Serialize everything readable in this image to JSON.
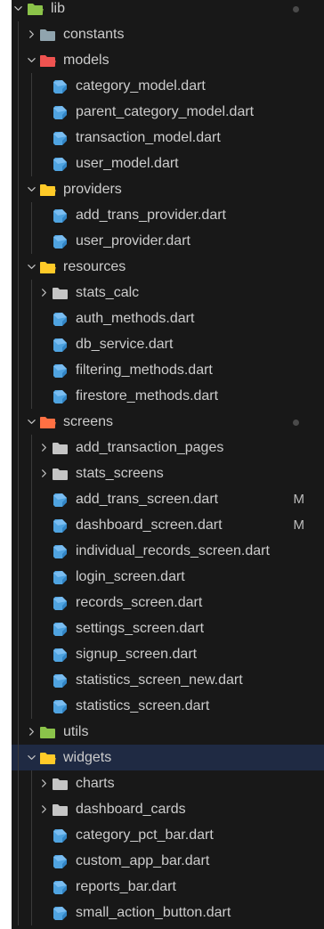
{
  "explorer": {
    "rows": [
      {
        "depth": 0,
        "type": "folder",
        "label": "lib",
        "expanded": true,
        "icon": "folder-open-lib-icon",
        "color": "#8bc34a",
        "dot": true
      },
      {
        "depth": 1,
        "type": "folder",
        "label": "constants",
        "expanded": false,
        "icon": "folder-constants-icon",
        "color": "#90a4ae"
      },
      {
        "depth": 1,
        "type": "folder",
        "label": "models",
        "expanded": true,
        "icon": "folder-open-models-icon",
        "color": "#ef5350"
      },
      {
        "depth": 2,
        "type": "file",
        "label": "category_model.dart",
        "icon": "dart-file-icon"
      },
      {
        "depth": 2,
        "type": "file",
        "label": "parent_category_model.dart",
        "icon": "dart-file-icon"
      },
      {
        "depth": 2,
        "type": "file",
        "label": "transaction_model.dart",
        "icon": "dart-file-icon"
      },
      {
        "depth": 2,
        "type": "file",
        "label": "user_model.dart",
        "icon": "dart-file-icon"
      },
      {
        "depth": 1,
        "type": "folder",
        "label": "providers",
        "expanded": true,
        "icon": "folder-open-providers-icon",
        "color": "#ffca28"
      },
      {
        "depth": 2,
        "type": "file",
        "label": "add_trans_provider.dart",
        "icon": "dart-file-icon"
      },
      {
        "depth": 2,
        "type": "file",
        "label": "user_provider.dart",
        "icon": "dart-file-icon"
      },
      {
        "depth": 1,
        "type": "folder",
        "label": "resources",
        "expanded": true,
        "icon": "folder-open-resources-icon",
        "color": "#ffca28"
      },
      {
        "depth": 2,
        "type": "folder",
        "label": "stats_calc",
        "expanded": false,
        "icon": "folder-icon",
        "color": "#c5c5c5"
      },
      {
        "depth": 2,
        "type": "file",
        "label": "auth_methods.dart",
        "icon": "dart-file-icon"
      },
      {
        "depth": 2,
        "type": "file",
        "label": "db_service.dart",
        "icon": "dart-file-icon"
      },
      {
        "depth": 2,
        "type": "file",
        "label": "filtering_methods.dart",
        "icon": "dart-file-icon"
      },
      {
        "depth": 2,
        "type": "file",
        "label": "firestore_methods.dart",
        "icon": "dart-file-icon"
      },
      {
        "depth": 1,
        "type": "folder",
        "label": "screens",
        "expanded": true,
        "icon": "folder-open-screens-icon",
        "color": "#ff7043",
        "dot": true
      },
      {
        "depth": 2,
        "type": "folder",
        "label": "add_transaction_pages",
        "expanded": false,
        "icon": "folder-icon",
        "color": "#c5c5c5"
      },
      {
        "depth": 2,
        "type": "folder",
        "label": "stats_screens",
        "expanded": false,
        "icon": "folder-icon",
        "color": "#c5c5c5"
      },
      {
        "depth": 2,
        "type": "file",
        "label": "add_trans_screen.dart",
        "icon": "dart-file-icon",
        "badge": "M"
      },
      {
        "depth": 2,
        "type": "file",
        "label": "dashboard_screen.dart",
        "icon": "dart-file-icon",
        "badge": "M"
      },
      {
        "depth": 2,
        "type": "file",
        "label": "individual_records_screen.dart",
        "icon": "dart-file-icon"
      },
      {
        "depth": 2,
        "type": "file",
        "label": "login_screen.dart",
        "icon": "dart-file-icon"
      },
      {
        "depth": 2,
        "type": "file",
        "label": "records_screen.dart",
        "icon": "dart-file-icon"
      },
      {
        "depth": 2,
        "type": "file",
        "label": "settings_screen.dart",
        "icon": "dart-file-icon"
      },
      {
        "depth": 2,
        "type": "file",
        "label": "signup_screen.dart",
        "icon": "dart-file-icon"
      },
      {
        "depth": 2,
        "type": "file",
        "label": "statistics_screen_new.dart",
        "icon": "dart-file-icon"
      },
      {
        "depth": 2,
        "type": "file",
        "label": "statistics_screen.dart",
        "icon": "dart-file-icon"
      },
      {
        "depth": 1,
        "type": "folder",
        "label": "utils",
        "expanded": false,
        "icon": "folder-utils-icon",
        "color": "#8bc34a"
      },
      {
        "depth": 1,
        "type": "folder",
        "label": "widgets",
        "expanded": true,
        "icon": "folder-open-widgets-icon",
        "color": "#ffca28",
        "selected": true
      },
      {
        "depth": 2,
        "type": "folder",
        "label": "charts",
        "expanded": false,
        "icon": "folder-icon",
        "color": "#c5c5c5"
      },
      {
        "depth": 2,
        "type": "folder",
        "label": "dashboard_cards",
        "expanded": false,
        "icon": "folder-icon",
        "color": "#c5c5c5"
      },
      {
        "depth": 2,
        "type": "file",
        "label": "category_pct_bar.dart",
        "icon": "dart-file-icon"
      },
      {
        "depth": 2,
        "type": "file",
        "label": "custom_app_bar.dart",
        "icon": "dart-file-icon"
      },
      {
        "depth": 2,
        "type": "file",
        "label": "reports_bar.dart",
        "icon": "dart-file-icon"
      },
      {
        "depth": 2,
        "type": "file",
        "label": "small_action_button.dart",
        "icon": "dart-file-icon"
      }
    ]
  },
  "colors": {
    "background": "#181818",
    "text": "#cccccc",
    "selected": "#1f2a43",
    "dart": "#4fa3e0"
  }
}
